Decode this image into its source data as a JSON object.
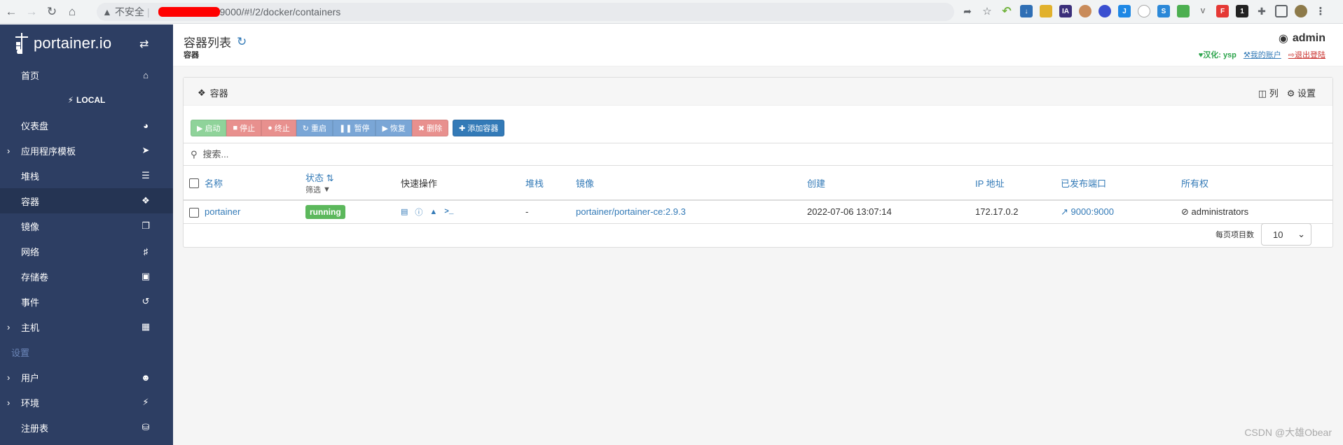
{
  "browser": {
    "insecure_label": "不安全",
    "url_tail": "9000/#!/2/docker/containers"
  },
  "sidebar": {
    "brand": "portainer.io",
    "items_top": [
      {
        "label": "首页",
        "icon": "home-icon"
      }
    ],
    "local_label": "LOCAL",
    "items": [
      {
        "label": "仪表盘",
        "icon": "dashboard-icon",
        "expandable": false,
        "active": false
      },
      {
        "label": "应用程序模板",
        "icon": "rocket-icon",
        "expandable": true,
        "active": false
      },
      {
        "label": "堆栈",
        "icon": "list-icon",
        "expandable": false,
        "active": false
      },
      {
        "label": "容器",
        "icon": "cubes-icon",
        "expandable": false,
        "active": true
      },
      {
        "label": "镜像",
        "icon": "clone-icon",
        "expandable": false,
        "active": false
      },
      {
        "label": "网络",
        "icon": "sitemap-icon",
        "expandable": false,
        "active": false
      },
      {
        "label": "存储卷",
        "icon": "hdd-icon",
        "expandable": false,
        "active": false
      },
      {
        "label": "事件",
        "icon": "history-icon",
        "expandable": false,
        "active": false
      },
      {
        "label": "主机",
        "icon": "th-icon",
        "expandable": true,
        "active": false
      }
    ],
    "section_settings": "设置",
    "settings_items": [
      {
        "label": "用户",
        "icon": "users-icon",
        "expandable": true
      },
      {
        "label": "环境",
        "icon": "plug-icon",
        "expandable": true
      },
      {
        "label": "注册表",
        "icon": "database-icon",
        "expandable": false
      }
    ]
  },
  "header": {
    "title": "容器列表",
    "breadcrumb": "容器",
    "user": "admin",
    "localized_by": "汉化: ysp",
    "my_account": "我的账户",
    "logout": "退出登陆"
  },
  "widget": {
    "title": "容器",
    "columns_label": "列",
    "settings_label": "设置",
    "buttons": {
      "start": "启动",
      "stop": "停止",
      "kill": "终止",
      "restart": "重启",
      "pause": "暂停",
      "resume": "恢复",
      "remove": "删除",
      "add": "添加容器"
    },
    "search_placeholder": "搜索...",
    "table": {
      "headers": {
        "name": "名称",
        "status": "状态",
        "filter": "筛选",
        "quick_actions": "快速操作",
        "stack": "堆栈",
        "image": "镜像",
        "created": "创建",
        "ip": "IP 地址",
        "ports": "已发布端口",
        "ownership": "所有权"
      },
      "rows": [
        {
          "name": "portainer",
          "status": "running",
          "stack": "-",
          "image": "portainer/portainer-ce:2.9.3",
          "created": "2022-07-06 13:07:14",
          "ip": "172.17.0.2",
          "ports": "9000:9000",
          "ownership": "administrators"
        }
      ]
    },
    "pager": {
      "label": "每页项目数",
      "value": "10"
    }
  },
  "watermark": "CSDN @大雄Obear"
}
